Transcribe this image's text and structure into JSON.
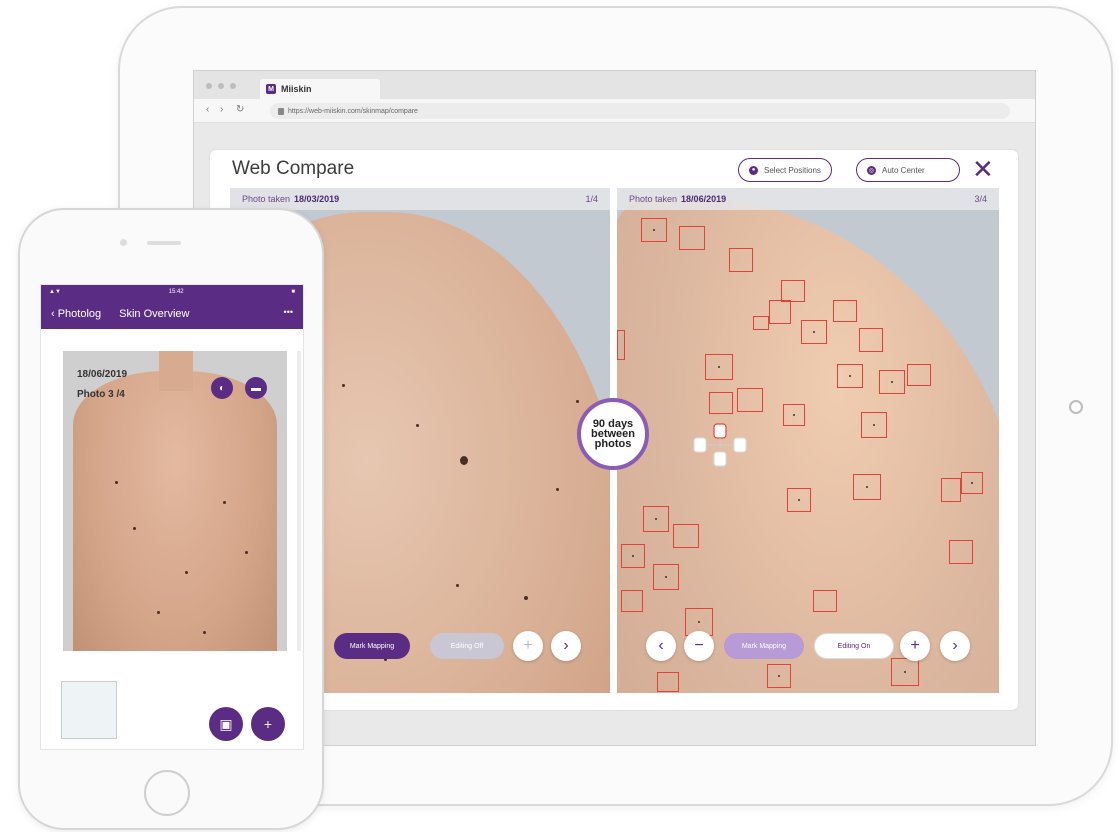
{
  "browser": {
    "tab_title": "Miiskin",
    "url": "https://web-miiskin.com/skinmap/compare"
  },
  "modal": {
    "title": "Web Compare",
    "select_positions_label": "Select Positions",
    "auto_center_label": "Auto Center",
    "close_glyph": "✕"
  },
  "left_panel": {
    "header_prefix": "Photo taken",
    "date": "18/03/2019",
    "counter": "1/4",
    "mark_mapping_label": "Mark Mapping",
    "editing_label": "Editing Off",
    "zoom_in_glyph": "+",
    "next_glyph": "›"
  },
  "right_panel": {
    "header_prefix": "Photo taken",
    "date": "18/06/2019",
    "counter": "3/4",
    "prev_glyph": "‹",
    "zoom_out_glyph": "−",
    "mark_mapping_label": "Mark Mapping",
    "editing_label": "Editing On",
    "zoom_in_glyph": "+",
    "next_glyph": "›"
  },
  "days_badge": {
    "line1": "90 days",
    "line2": "between",
    "line3": "photos"
  },
  "phone": {
    "status_time": "15:42",
    "back_label": "‹ Photolog",
    "title": "Skin Overview",
    "menu_glyph": "•••",
    "photo_date": "18/06/2019",
    "photo_number": "Photo 3 /4",
    "fab_add_glyph": "+"
  },
  "colors": {
    "brand_purple": "#5b2c83",
    "marker_red": "#e5413b"
  }
}
